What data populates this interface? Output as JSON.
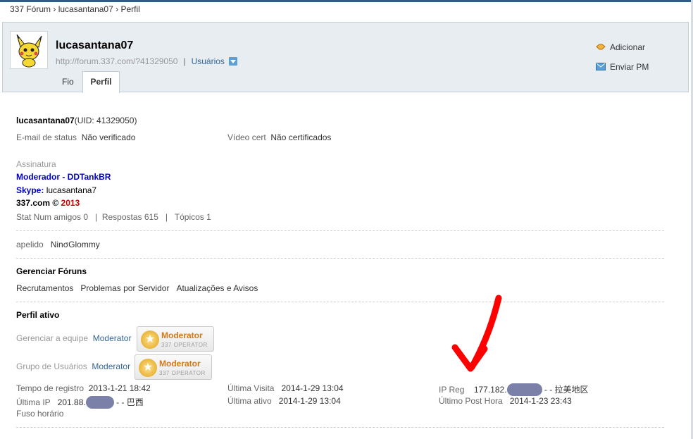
{
  "breadcrumb": {
    "items": [
      "337 Fórum",
      "lucasantana07",
      "Perfil"
    ],
    "sep": " › "
  },
  "header": {
    "username": "lucasantana07",
    "url": "http://forum.337.com/?41329050",
    "sep": "|",
    "group": "Usuários",
    "actions": [
      {
        "label": "Adicionar",
        "icon": "handshake-icon"
      },
      {
        "label": "Enviar PM",
        "icon": "envelope-icon"
      }
    ],
    "tabs": [
      "Fio",
      "Perfil"
    ]
  },
  "profile": {
    "name": "lucasantana07",
    "uid": "(UID: 41329050)",
    "email_label": "E-mail de status",
    "email_value": "Não verificado",
    "video_label": "Vídeo cert",
    "video_value": "Não certificados",
    "signature_label": "Assinatura",
    "sig_line1": "Moderador - DDTankBR",
    "sig_skype_label": "Skype:",
    "sig_skype_value": " lucasantana7",
    "sig_site": "337.com © ",
    "sig_year": "2013",
    "stats": "Stat Num amigos 0   |  Respostas 615   |   Tópicos 1",
    "nick_label": "apelido",
    "nick_value": "NinσGlommy"
  },
  "forums": {
    "title": "Gerenciar Fóruns",
    "items": [
      "Recrutamentos",
      "Problemas por Servidor",
      "Atualizações e Avisos"
    ]
  },
  "active": {
    "title": "Perfil ativo",
    "team_label": "Gerenciar a equipe",
    "team_value": "Moderator",
    "group_label": "Grupo de Usuários",
    "group_value": "Moderator",
    "badge_title": "Moderator",
    "badge_sub": "337 OPERATOR",
    "reg_label": "Tempo de registro",
    "reg_value": "2013-1-21 18:42",
    "lastip_label": "Última IP",
    "lastip_value": "201.88.",
    "lastip_tail": "- - 巴西",
    "tz_label": "Fuso horário",
    "visit_label": "Última Visita",
    "visit_value": "2014-1-29 13:04",
    "active_label": "Última ativo",
    "active_value": "2014-1-29 13:04",
    "ipreg_label": "IP Reg",
    "ipreg_value": "177.182.",
    "ipreg_tail": "- - 拉美地区",
    "post_label": "Último Post Hora",
    "post_value": "2014-1-23 23:43"
  },
  "colors": {
    "accent": "#336699",
    "signature_blue": "#0000cc",
    "year_red": "#cc0000",
    "arrow_red": "#ff0000"
  }
}
